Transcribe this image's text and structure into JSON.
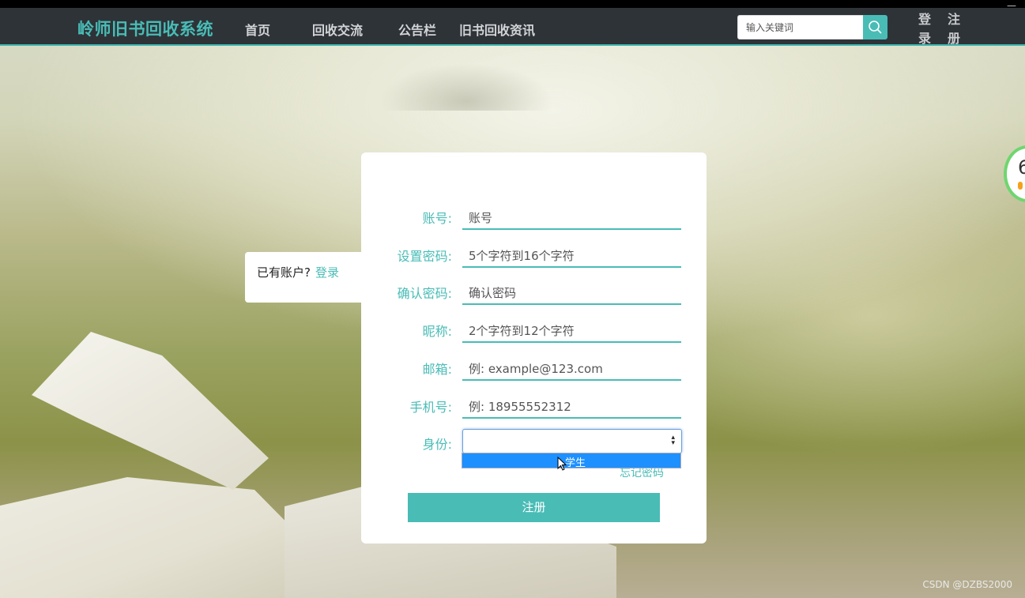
{
  "window": {
    "minimize_glyph": "—"
  },
  "nav": {
    "brand": "岭师旧书回收系统",
    "links": [
      "首页",
      "回收交流",
      "公告栏",
      "旧书回收资讯"
    ],
    "search_placeholder": "输入关键词",
    "search_icon": "search-icon",
    "login_chars": [
      "登",
      "录"
    ],
    "register_chars": [
      "注",
      "册"
    ]
  },
  "hint": {
    "text": "已有账户?",
    "login_link": "登录"
  },
  "form": {
    "fields": [
      {
        "label": "账号:",
        "placeholder": "账号"
      },
      {
        "label": "设置密码:",
        "placeholder": "5个字符到16个字符"
      },
      {
        "label": "确认密码:",
        "placeholder": "确认密码"
      },
      {
        "label": "昵称:",
        "placeholder": "2个字符到12个字符"
      },
      {
        "label": "邮箱:",
        "placeholder": "例: example@123.com"
      },
      {
        "label": "手机号:",
        "placeholder": "例: 18955552312"
      }
    ],
    "identity_label": "身份:",
    "identity_value": "",
    "identity_options": [
      "学生"
    ],
    "forgot_password": "忘记密码",
    "submit_label": "注册"
  },
  "widget": {
    "number": "6"
  },
  "watermark": "CSDN @DZBS2000",
  "colors": {
    "accent": "#49bcb6",
    "navbar": "#2e3338",
    "dropdown_highlight": "#1e90ff"
  }
}
